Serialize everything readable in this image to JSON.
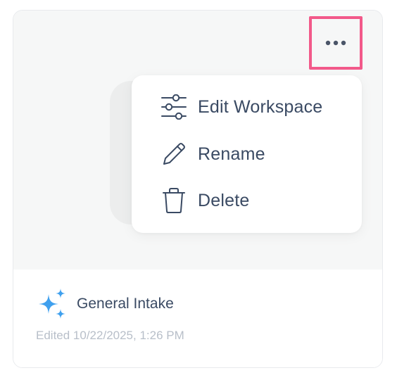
{
  "menu": {
    "items": [
      {
        "label": "Edit Workspace",
        "icon": "sliders-icon"
      },
      {
        "label": "Rename",
        "icon": "pencil-icon"
      },
      {
        "label": "Delete",
        "icon": "trash-icon"
      }
    ]
  },
  "card": {
    "title": "General Intake",
    "edited": "Edited 10/22/2025, 1:26 PM",
    "title_icon": "sparkle-icon"
  },
  "colors": {
    "highlight": "#f2598a",
    "text": "#3a4a63",
    "muted": "#b8bfc9",
    "sparkle": "#3fa0ee"
  }
}
